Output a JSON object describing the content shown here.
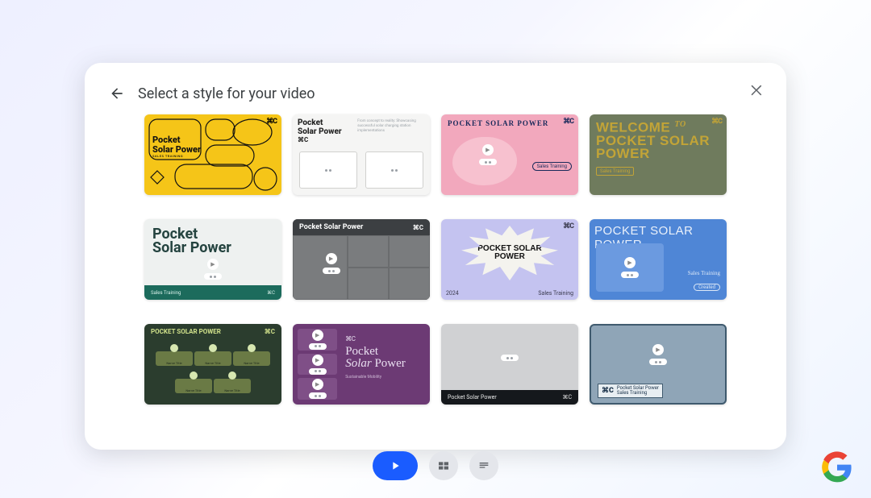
{
  "dialog": {
    "title": "Select a style for your video"
  },
  "marks": {
    "loop": "⌘C"
  },
  "styles": [
    {
      "id": "s1",
      "title": "Pocket\nSolar Power",
      "sub": "SALES TRAINING"
    },
    {
      "id": "s2",
      "title": "Pocket\nSolar Power",
      "blurb": "From concept to reality: Showcasing successful solar charging station implementations"
    },
    {
      "id": "s3",
      "title": "POCKET SOLAR POWER",
      "tag": "Sales Training"
    },
    {
      "id": "s4",
      "welcome": "WELCOME",
      "to": "TO",
      "line2": "POCKET SOLAR",
      "line3": "POWER",
      "chip": "Sales Training"
    },
    {
      "id": "s5",
      "title": "Pocket\nSolar Power",
      "footer": "Sales Training"
    },
    {
      "id": "s6",
      "title": "Pocket Solar Power"
    },
    {
      "id": "s7",
      "title": "POCKET SOLAR\nPOWER",
      "year": "2024",
      "footer": "Sales Training"
    },
    {
      "id": "s8",
      "title": "POCKET SOLAR POWER",
      "sideA": "Sales Training",
      "sideB": "Created"
    },
    {
      "id": "s9",
      "title": "POCKET SOLAR POWER",
      "node": "Name Title"
    },
    {
      "id": "s10",
      "title_a": "Pocket",
      "title_b": "Solar",
      "title_c": "Power",
      "sub": "Sustainable Mobility"
    },
    {
      "id": "s11",
      "title": "Pocket Solar Power"
    },
    {
      "id": "s12",
      "title": "Pocket Solar Power",
      "sub": "Sales Training"
    }
  ]
}
